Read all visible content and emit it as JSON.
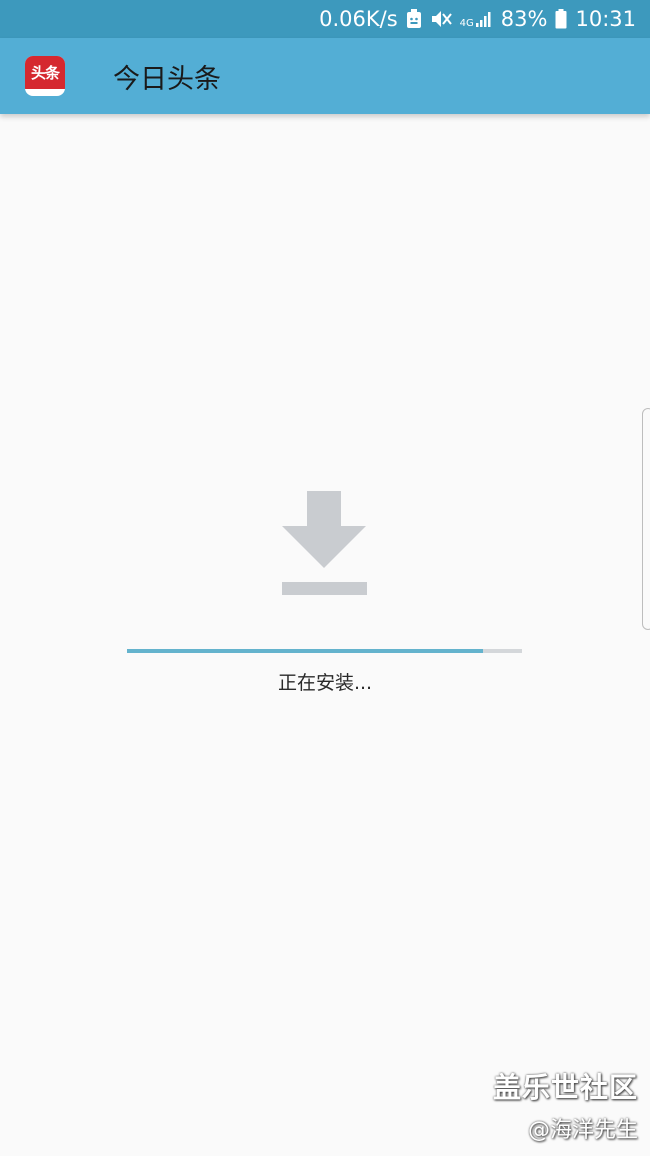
{
  "status_bar": {
    "net_speed": "0.06K/s",
    "network_type": "4G",
    "battery_percent": "83%",
    "time": "10:31",
    "icons": [
      "android-notification-icon",
      "mute-icon",
      "signal-icon",
      "battery-icon"
    ]
  },
  "app_bar": {
    "app_icon_text": "头条",
    "title": "今日头条"
  },
  "install": {
    "status_text": "正在安装...",
    "progress_fraction": 0.9,
    "icon": "download-icon"
  },
  "watermark": {
    "line1": "盖乐世社区",
    "line2": "@海洋先生"
  },
  "colors": {
    "status_bar": "#3d99bd",
    "app_bar": "#53aed5",
    "app_icon_red": "#d5282f",
    "progress_fill": "#64b3cd",
    "progress_track": "#d4d7da",
    "download_icon": "#c9ccd0"
  }
}
